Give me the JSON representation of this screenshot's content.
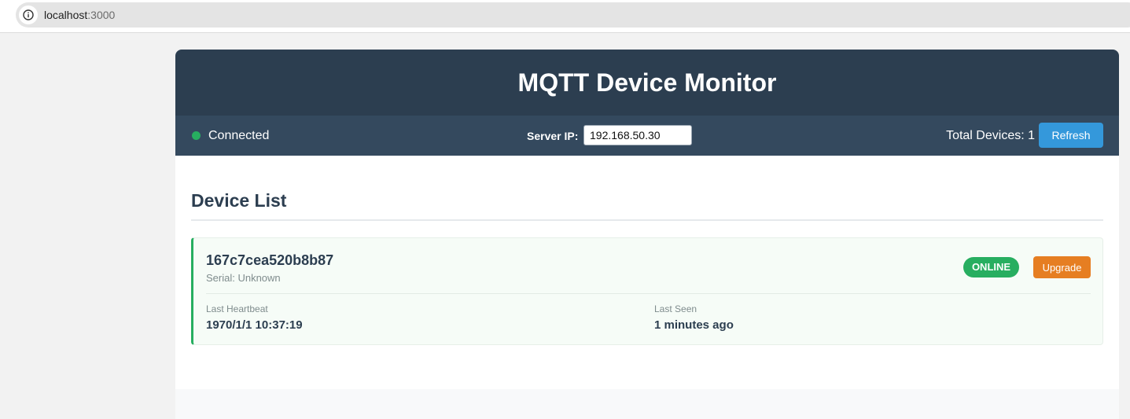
{
  "browser": {
    "url_host": "localhost",
    "url_port": ":3000",
    "info_icon": "info-icon"
  },
  "header": {
    "title": "MQTT Device Monitor"
  },
  "status_bar": {
    "connection_status": "Connected",
    "connection_color": "#27ae60",
    "server_ip_label": "Server IP:",
    "server_ip_value": "192.168.50.30",
    "total_devices_label": "Total Devices: 1",
    "refresh_label": "Refresh"
  },
  "device_list": {
    "title": "Device List",
    "devices": [
      {
        "id": "167c7cea520b8b87",
        "serial": "Serial: Unknown",
        "status": "ONLINE",
        "status_color": "#27ae60",
        "upgrade_label": "Upgrade",
        "upgrade_color": "#e67e22",
        "last_heartbeat_label": "Last Heartbeat",
        "last_heartbeat_value": "1970/1/1 10:37:19",
        "last_seen_label": "Last Seen",
        "last_seen_value": "1 minutes ago"
      }
    ]
  },
  "colors": {
    "header_bg": "#2c3e50",
    "status_bar_bg": "#34495e",
    "refresh_button": "#3498db"
  }
}
